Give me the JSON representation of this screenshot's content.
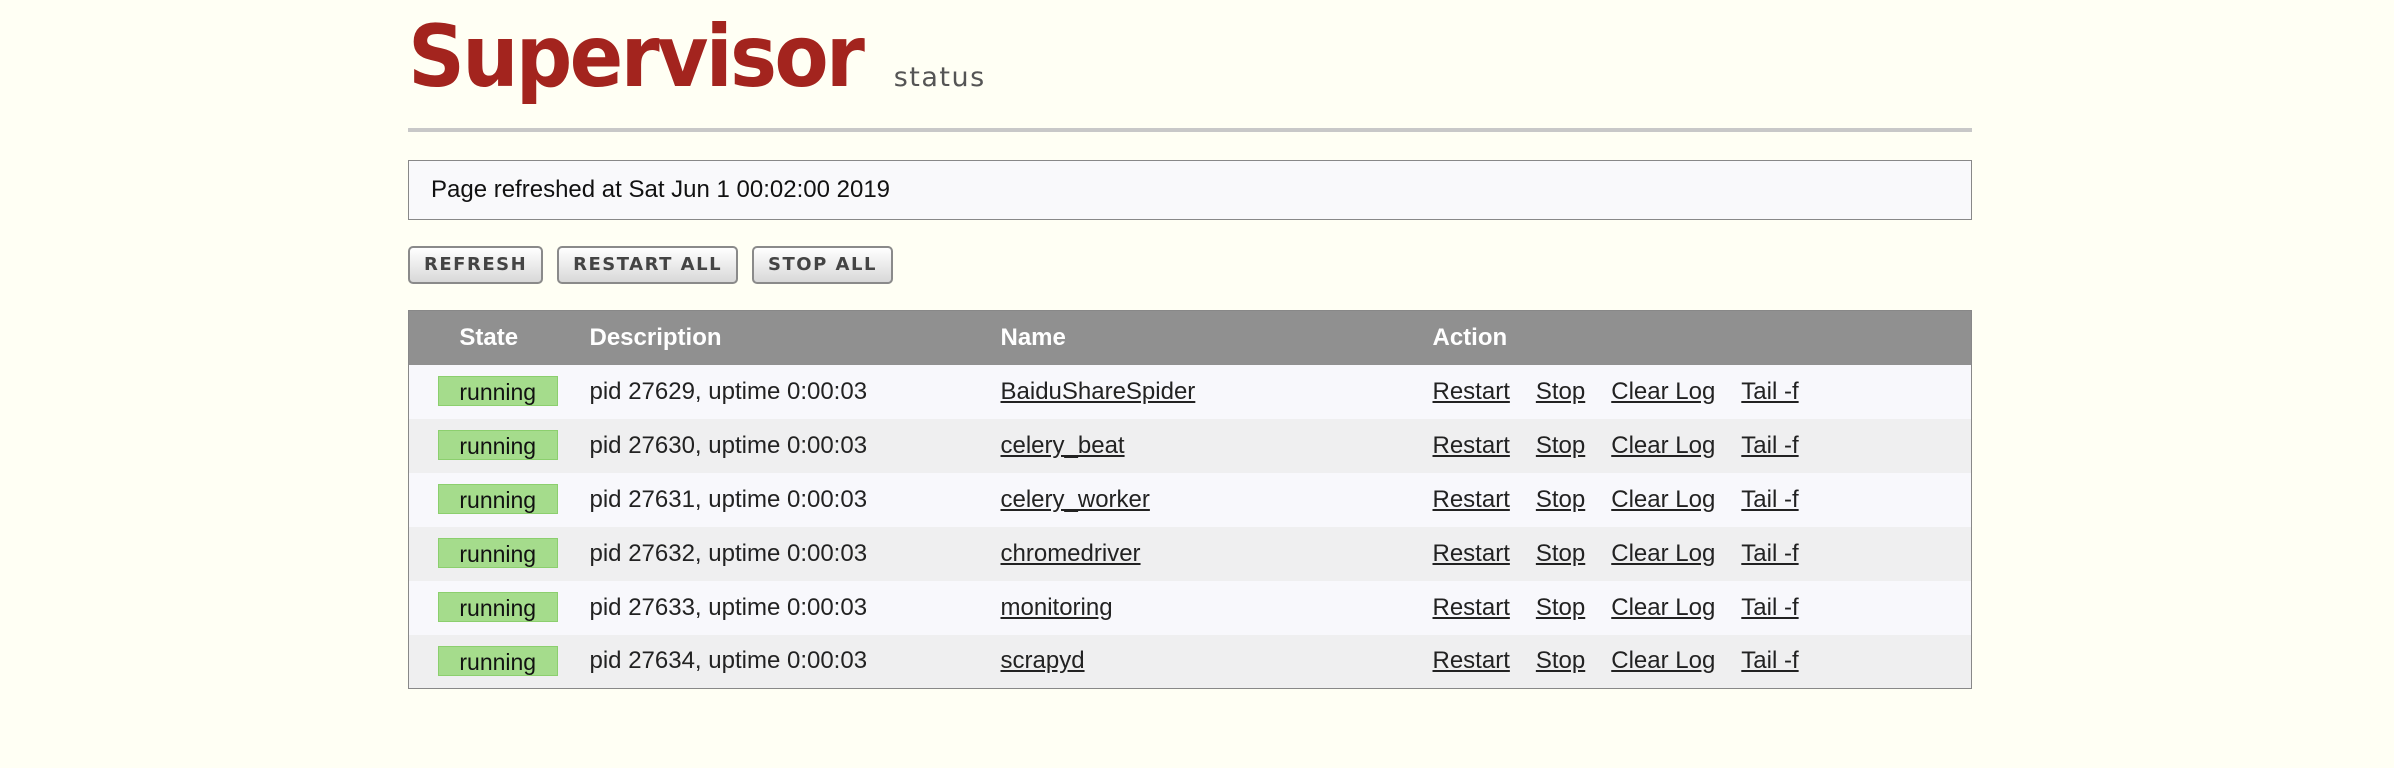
{
  "header": {
    "title": "Supervisor",
    "subtitle": "status"
  },
  "refresh_message": "Page refreshed at Sat Jun 1 00:02:00 2019",
  "buttons": {
    "refresh": "REFRESH",
    "restart_all": "RESTART ALL",
    "stop_all": "STOP ALL"
  },
  "table": {
    "headers": {
      "state": "State",
      "description": "Description",
      "name": "Name",
      "action": "Action"
    },
    "rows": [
      {
        "state": "running",
        "description": "pid 27629, uptime 0:00:03",
        "name": "BaiduShareSpider"
      },
      {
        "state": "running",
        "description": "pid 27630, uptime 0:00:03",
        "name": "celery_beat"
      },
      {
        "state": "running",
        "description": "pid 27631, uptime 0:00:03",
        "name": "celery_worker"
      },
      {
        "state": "running",
        "description": "pid 27632, uptime 0:00:03",
        "name": "chromedriver"
      },
      {
        "state": "running",
        "description": "pid 27633, uptime 0:00:03",
        "name": "monitoring"
      },
      {
        "state": "running",
        "description": "pid 27634, uptime 0:00:03",
        "name": "scrapyd"
      }
    ],
    "actions": {
      "restart": "Restart",
      "stop": "Stop",
      "clear_log": "Clear Log",
      "tail": "Tail -f"
    }
  },
  "colors": {
    "logo": "#a3241e",
    "running_badge": "#a5dc8c",
    "header_row": "#909090",
    "page_background": "#fffff4"
  }
}
